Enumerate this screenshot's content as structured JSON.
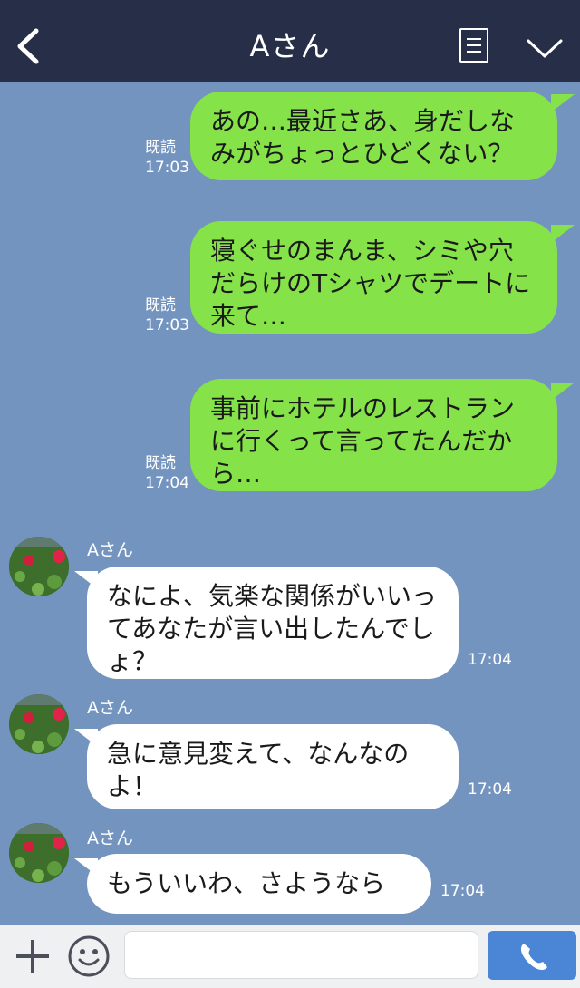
{
  "header": {
    "title": "Aさん",
    "back_icon": "chevron-left-icon",
    "menu_icon": "menu-list-icon",
    "collapse_icon": "chevron-down-icon",
    "bg_color": "#262f47"
  },
  "chat": {
    "bg_color": "#7494c0",
    "outgoing": [
      {
        "text": "あの…最近さあ、身だしなみがちょっとひどくない？",
        "read": "既読",
        "time": "17:03"
      },
      {
        "text": "寝ぐせのまんま、シミや穴だらけのTシャツでデートに来て…",
        "read": "既読",
        "time": "17:03"
      },
      {
        "text": "事前にホテルのレストランに行くって言ってたんだから…",
        "read": "既読",
        "time": "17:04"
      }
    ],
    "incoming": [
      {
        "sender": "Aさん",
        "text": "なによ、気楽な関係がいいってあなたが言い出したんでしょ？",
        "time": "17:04"
      },
      {
        "sender": "Aさん",
        "text": "急に意見変えて、なんなのよ！",
        "time": "17:04"
      },
      {
        "sender": "Aさん",
        "text": "もういいわ、さようなら",
        "time": "17:04"
      }
    ],
    "outgoing_color": "#85e249",
    "incoming_color": "#ffffff"
  },
  "input_bar": {
    "plus_icon": "plus-icon",
    "emoji_icon": "smiley-icon",
    "message_value": "",
    "call_icon": "phone-icon",
    "call_color": "#4b86d6"
  }
}
